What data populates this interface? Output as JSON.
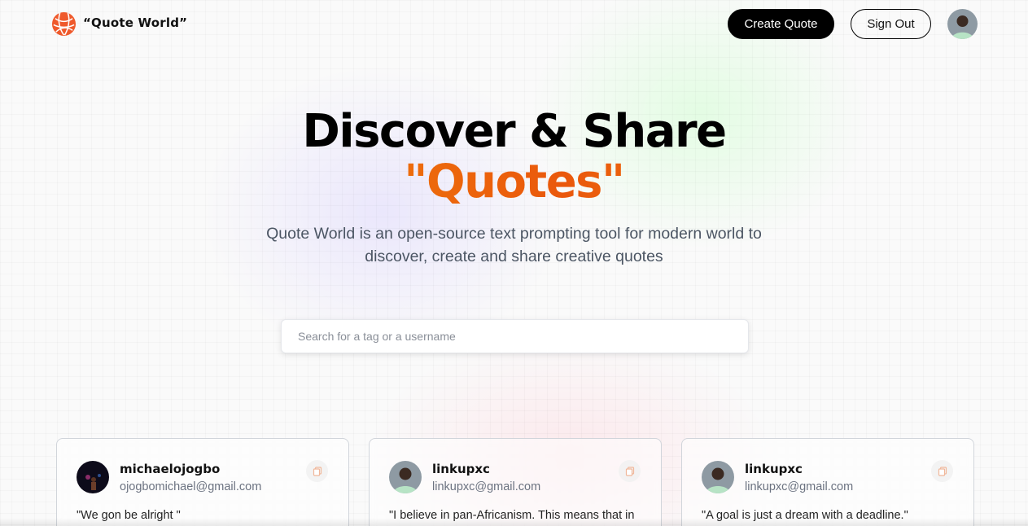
{
  "nav": {
    "logo_text": "“Quote World”",
    "create_label": "Create Quote",
    "signout_label": "Sign Out",
    "logo_icon": "globe-icon",
    "avatar_icon": "user-avatar"
  },
  "hero": {
    "title": "Discover & Share",
    "accent": "\"Quotes\"",
    "description": "Quote World is an open-source text prompting tool for modern world to discover, create and share creative quotes"
  },
  "search": {
    "placeholder": "Search for a tag or a username",
    "value": ""
  },
  "cards": [
    {
      "username": "michaelojogbo",
      "email": "ojogbomichael@gmail.com",
      "quote": "\"We gon be alright \""
    },
    {
      "username": "linkupxc",
      "email": "linkupxc@gmail.com",
      "quote": "\"I believe in pan-Africanism. This means that in"
    },
    {
      "username": "linkupxc",
      "email": "linkupxc@gmail.com",
      "quote": "\"A goal is just a dream with a deadline.\""
    }
  ],
  "colors": {
    "accent_start": "#f59e0b",
    "accent_end": "#ea580c",
    "logo": "#ef5a2c",
    "copy_icon": "#f0b79a"
  }
}
